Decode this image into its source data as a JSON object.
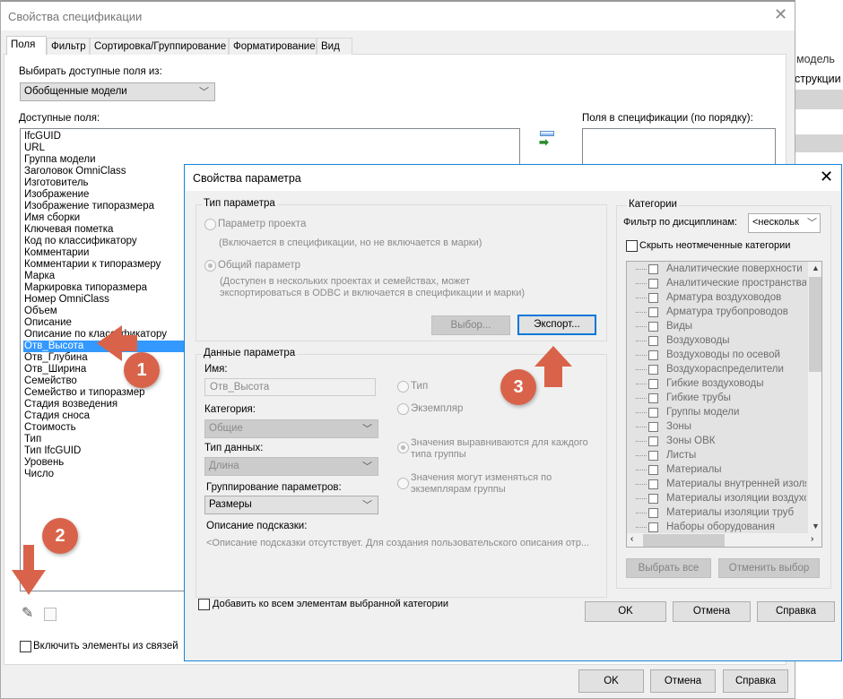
{
  "background_app": {
    "items": [
      "модель",
      "струкции"
    ]
  },
  "main": {
    "title": "Свойства спецификации",
    "tabs": [
      "Поля",
      "Фильтр",
      "Сортировка/Группирование",
      "Форматирование",
      "Вид"
    ],
    "source_label": "Выбирать доступные поля из:",
    "source_value": "Обобщенные модели",
    "available_label": "Доступные поля:",
    "available_fields": [
      "IfcGUID",
      "URL",
      "Группа модели",
      "Заголовок OmniClass",
      "Изготовитель",
      "Изображение",
      "Изображение типоразмера",
      "Имя сборки",
      "Ключевая пометка",
      "Код по классификатору",
      "Комментарии",
      "Комментарии к типоразмеру",
      "Марка",
      "Маркировка типоразмера",
      "Номер OmniClass",
      "Объем",
      "Описание",
      "Описание по классификатору",
      "Отв_Высота",
      "Отв_Глубина",
      "Отв_Ширина",
      "Семейство",
      "Семейство и типоразмер",
      "Стадия возведения",
      "Стадия сноса",
      "Стоимость",
      "Тип",
      "Тип IfcGUID",
      "Уровень",
      "Число"
    ],
    "selected_field": "Отв_Высота",
    "schedule_fields_label": "Поля в спецификации (по порядку):",
    "include_links_label": "Включить элементы из связей",
    "ok": "OK",
    "cancel": "Отмена",
    "help": "Справка"
  },
  "dialog": {
    "title": "Свойства параметра",
    "type_group": "Тип параметра",
    "project_param": "Параметр проекта",
    "project_hint": "(Включается в спецификации, но не включается в марки)",
    "shared_param": "Общий параметр",
    "shared_hint1": "(Доступен в нескольких проектах и семействах, может",
    "shared_hint2": "экспортироваться в ODBC и включается в спецификации и марки)",
    "select_btn": "Выбор...",
    "export_btn": "Экспорт...",
    "data_group": "Данные параметра",
    "name_label": "Имя:",
    "name_value": "Отв_Высота",
    "category_label": "Категория:",
    "category_value": "Общие",
    "datatype_label": "Тип данных:",
    "datatype_value": "Длина",
    "grouping_label": "Группирование параметров:",
    "grouping_value": "Размеры",
    "tooltip_label": "Описание подсказки:",
    "tooltip_value": "<Описание подсказки отсутствует. Для создания пользовательского описания отр...",
    "type_radio": "Тип",
    "instance_radio": "Экземпляр",
    "aligned1": "Значения выравниваются для каждого",
    "aligned2": "типа группы",
    "vary1": "Значения могут изменяться по",
    "vary2": "экземплярам группы",
    "categories_group": "Категории",
    "discipline_label": "Фильтр по дисциплинам:",
    "discipline_value": "<нескольк",
    "hide_unchecked": "Скрыть неотмеченные категории",
    "categories": [
      "Аналитические поверхности",
      "Аналитические пространства",
      "Арматура воздуховодов",
      "Арматура трубопроводов",
      "Виды",
      "Воздуховоды",
      "Воздуховоды по осевой",
      "Воздухораспределители",
      "Гибкие воздуховоды",
      "Гибкие трубы",
      "Группы модели",
      "Зоны",
      "Зоны ОВК",
      "Листы",
      "Материалы",
      "Материалы внутренней изоляц",
      "Материалы изоляции воздухов",
      "Материалы изоляции труб",
      "Наборы оборудования"
    ],
    "select_all": "Выбрать все",
    "deselect": "Отменить выбор",
    "add_all_label": "Добавить ко всем элементам выбранной категории",
    "ok": "OK",
    "cancel": "Отмена",
    "help": "Справка"
  },
  "annotations": {
    "b1": "1",
    "b2": "2",
    "b3": "3",
    "color": "#d9634a"
  }
}
